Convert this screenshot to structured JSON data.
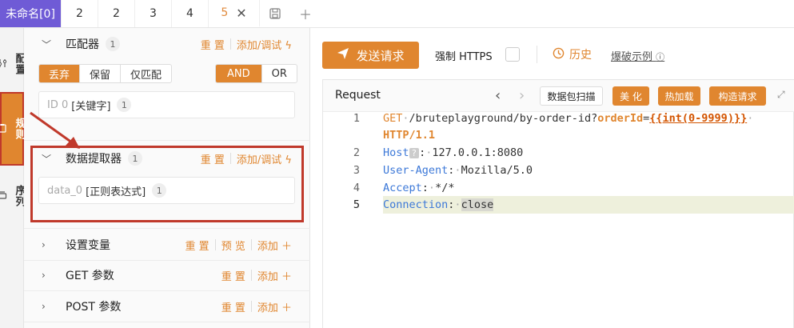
{
  "tabs": {
    "unnamed": "未命名[0]",
    "items": [
      "2",
      "2",
      "3",
      "4"
    ],
    "current": "5"
  },
  "vside": {
    "config": "配置",
    "rules": "规则",
    "sequence": "序列"
  },
  "matcher": {
    "title": "匹配器",
    "count": "1",
    "reset": "重 置",
    "add_debug": "添加/调试",
    "options": [
      "丢弃",
      "保留",
      "仅匹配"
    ],
    "logic": [
      "AND",
      "OR"
    ],
    "rule_id": "ID 0",
    "rule_type": "[关键字]",
    "rule_count": "1"
  },
  "extractor": {
    "title": "数据提取器",
    "count": "1",
    "reset": "重 置",
    "add_debug": "添加/调试",
    "rule_id": "data_0",
    "rule_type": "[正则表达式]",
    "rule_count": "1"
  },
  "sections": [
    {
      "title": "设置变量",
      "reset": "重 置",
      "extra": "预 览",
      "add": "添加"
    },
    {
      "title": "GET 参数",
      "reset": "重 置",
      "add": "添加"
    },
    {
      "title": "POST 参数",
      "reset": "重 置",
      "add": "添加"
    }
  ],
  "toolbar": {
    "send": "发送请求",
    "https": "强制 HTTPS",
    "history": "历史",
    "burst": "爆破示例"
  },
  "editor": {
    "title": "Request",
    "scan": "数据包扫描",
    "beautify": "美 化",
    "hotload": "热加载",
    "build": "构造请求"
  },
  "code": {
    "line_numbers": [
      "1",
      "2",
      "3",
      "4",
      "5"
    ],
    "l1_method": "GET",
    "l1_path": "/bruteplayground/by-order-id?",
    "l1_key": "orderId",
    "l1_eq": "=",
    "l1_tag": "{{int(0-9999)}}",
    "l1_ver": "HTTP/1.1",
    "l2_key": "Host",
    "l2_q": "?",
    "l2_val": "127.0.0.1:8080",
    "l3_key": "User-Agent",
    "l3_val": "Mozilla/5.0",
    "l4_key": "Accept",
    "l4_val": "*/*",
    "l5_key": "Connection",
    "l5_val": "close"
  },
  "colors": {
    "accent": "#e0862f",
    "tab_active": "#6f5bd6",
    "annotation": "#c0392b",
    "header_key": "#3c78d8"
  }
}
